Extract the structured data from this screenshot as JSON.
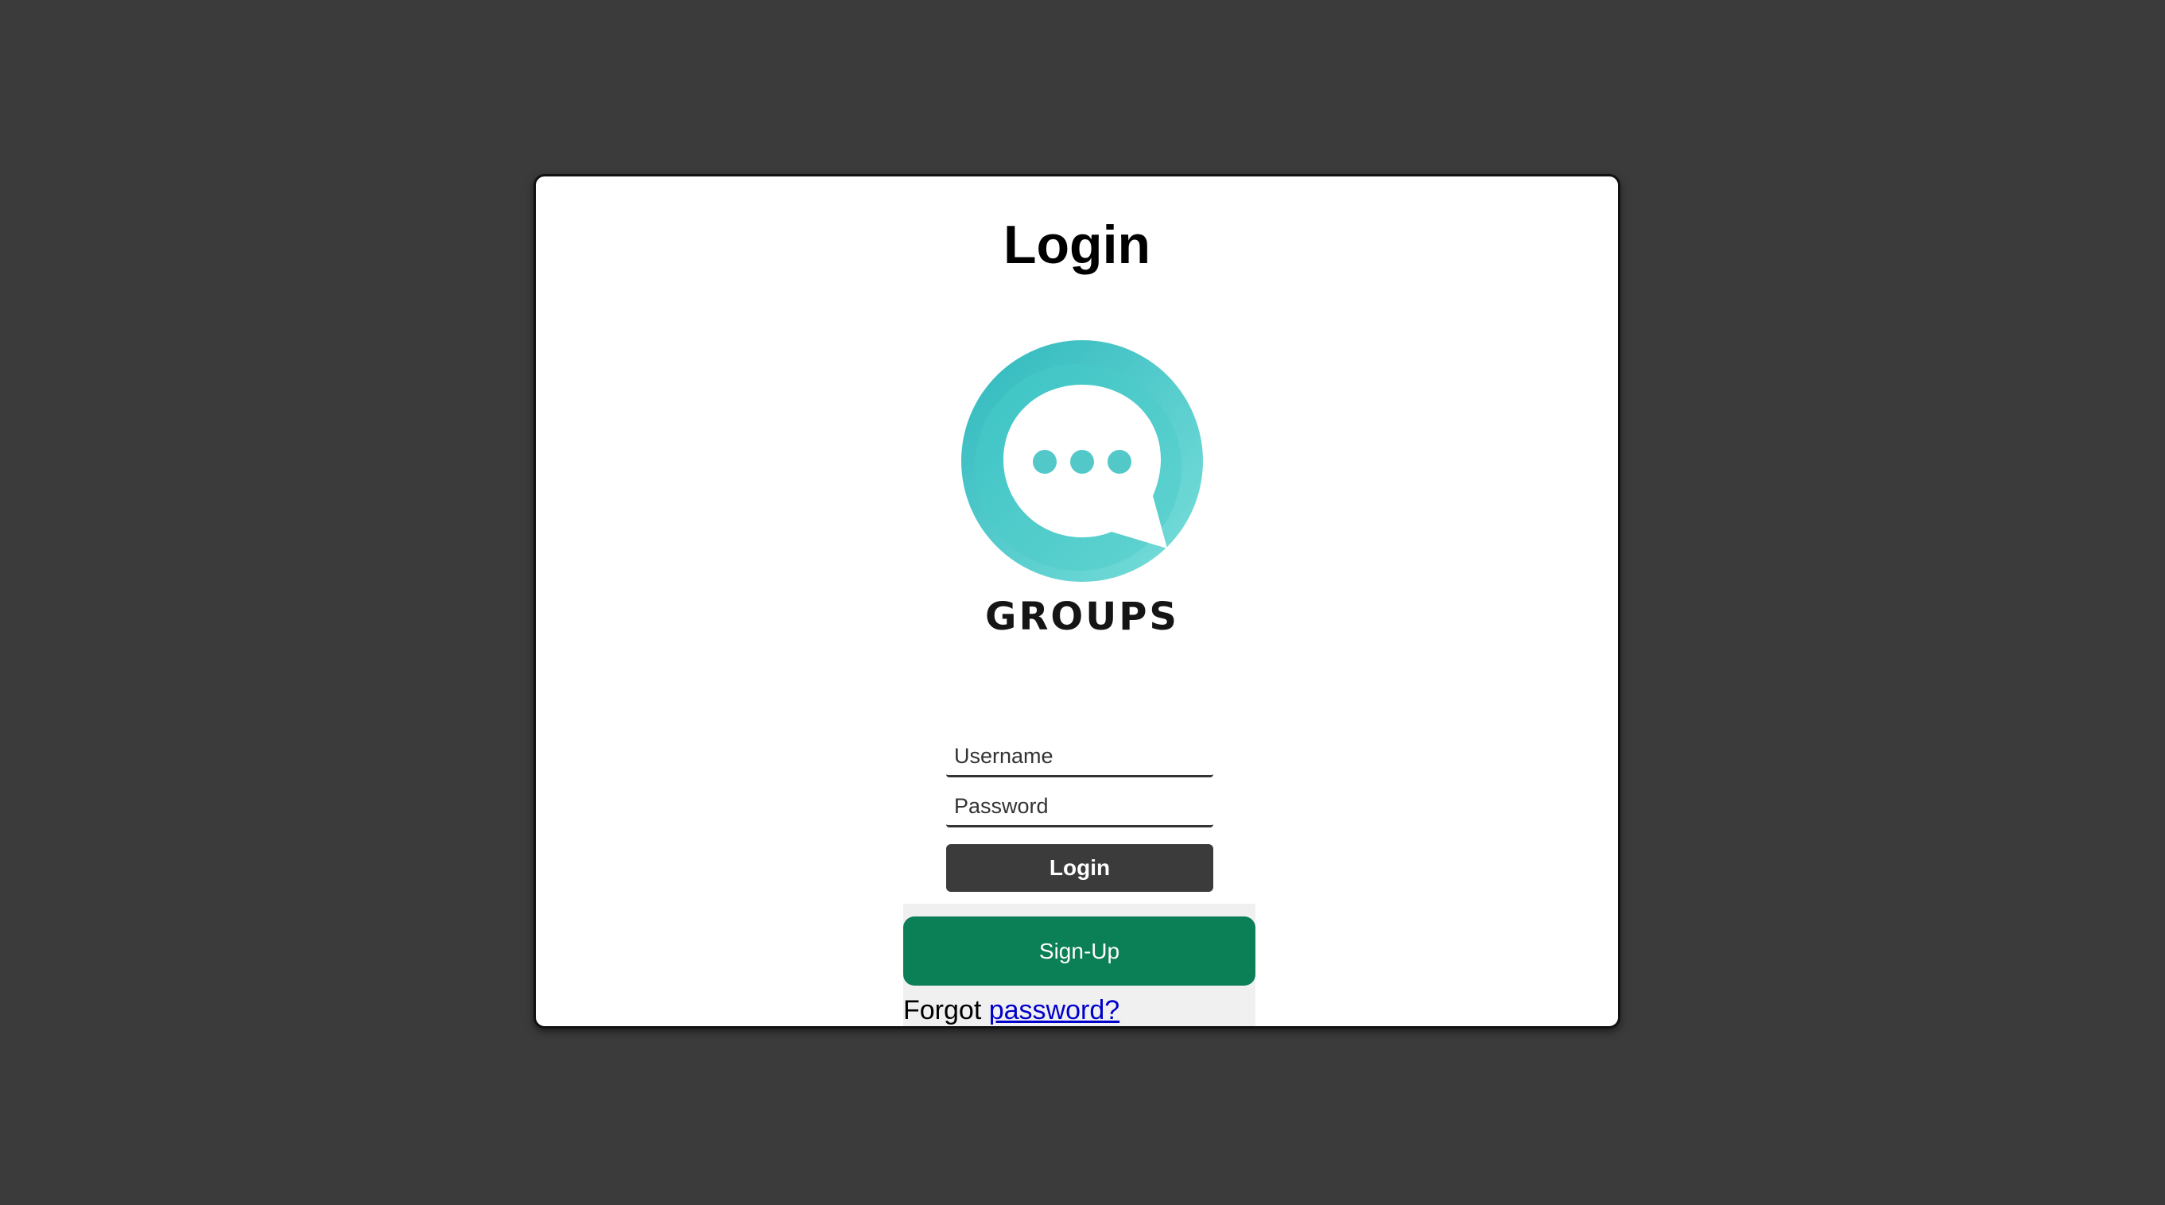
{
  "page": {
    "title": "Login"
  },
  "logo": {
    "text": "GROUPS",
    "icon": "chat-bubble-icon",
    "colors": {
      "ring_dark": "#2fb8bd",
      "ring_light": "#6ed8d6",
      "dots": "#52c9c8"
    }
  },
  "form": {
    "username_placeholder": "Username",
    "password_placeholder": "Password",
    "login_label": "Login",
    "signup_label": "Sign-Up",
    "forgot_prefix": "Forgot",
    "forgot_link": "password?"
  },
  "colors": {
    "background": "#3b3b3b",
    "login_button": "#3b3b3b",
    "signup_button": "#0b7f56",
    "link": "#0000cc"
  }
}
